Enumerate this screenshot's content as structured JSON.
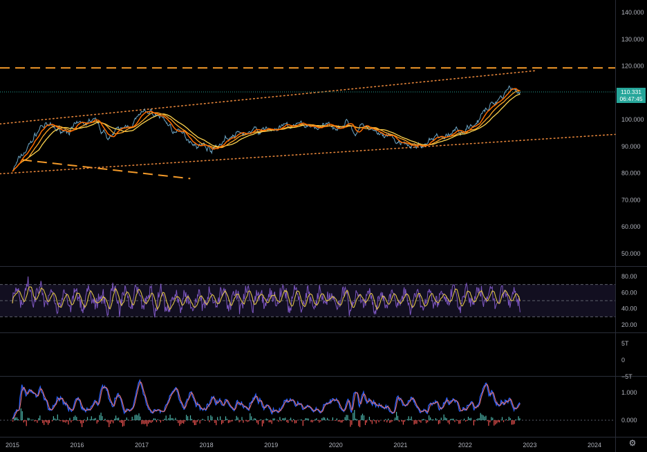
{
  "chart_data": [
    {
      "type": "line",
      "panel": "price",
      "y_ticks": [
        "140.000",
        "130.000",
        "120.000",
        "110.000",
        "100.000",
        "90.000",
        "80.000",
        "70.000",
        "60.000",
        "50.000"
      ],
      "ylim": [
        46,
        144
      ],
      "last_value": "110.331",
      "countdown": "06:47:45",
      "x_ticks": [
        "2015",
        "2016",
        "2017",
        "2018",
        "2019",
        "2020",
        "2021",
        "2022",
        "2023",
        "2024"
      ],
      "xlim": [
        2015.0,
        2024.35
      ],
      "series": [
        {
          "x": [
            2015.0,
            2015.25,
            2015.45,
            2015.7,
            2016.0,
            2016.25,
            2016.45,
            2016.7,
            2016.95,
            2017.1,
            2017.3,
            2017.55,
            2017.8,
            2018.1,
            2018.3,
            2018.6,
            2018.9,
            2019.2,
            2019.5,
            2019.8,
            2020.0,
            2020.2,
            2020.3,
            2020.45,
            2020.65,
            2020.9,
            2021.05,
            2021.2,
            2021.4,
            2021.6,
            2021.8,
            2022.0,
            2022.2,
            2022.4,
            2022.55,
            2022.7,
            2022.78,
            2022.85
          ],
          "y": [
            81,
            90,
            98,
            96,
            97,
            100,
            94,
            96,
            101,
            103,
            101,
            95,
            92,
            89,
            93,
            95,
            96,
            97,
            98,
            97,
            98,
            99,
            95,
            98,
            94,
            92,
            90,
            90,
            91,
            93,
            95,
            97,
            100,
            105,
            109,
            113,
            111,
            110.3
          ]
        }
      ],
      "colors": {
        "price": "#6ea8c8",
        "ma_fast": "#ff6d00",
        "ma_mid": "#ffa726",
        "ma_slow": "#ffd54f",
        "level": "#f59b2a",
        "channel": "#e8863a",
        "last_marker": "#26a69a"
      }
    },
    {
      "type": "line",
      "panel": "rsi",
      "y_ticks": [
        "80.00",
        "60.00",
        "40.00",
        "20.00"
      ],
      "ylim": [
        15,
        88
      ],
      "bands": [
        70,
        50,
        30
      ],
      "colors": {
        "rsi": "#7e57c2",
        "signal": "#e0c34b",
        "band": "#2a2440"
      }
    },
    {
      "type": "line",
      "panel": "empty",
      "y_ticks": [
        "5T",
        "0",
        "−5T"
      ]
    },
    {
      "type": "bar",
      "panel": "histogram",
      "y_ticks": [
        "1.000",
        "0.000"
      ],
      "ylim": [
        -0.55,
        1.55
      ],
      "colors": {
        "positive": "#4db6ac",
        "negative": "#ef5350",
        "line_a": "#2962ff",
        "line_b": "#e57373"
      }
    }
  ]
}
